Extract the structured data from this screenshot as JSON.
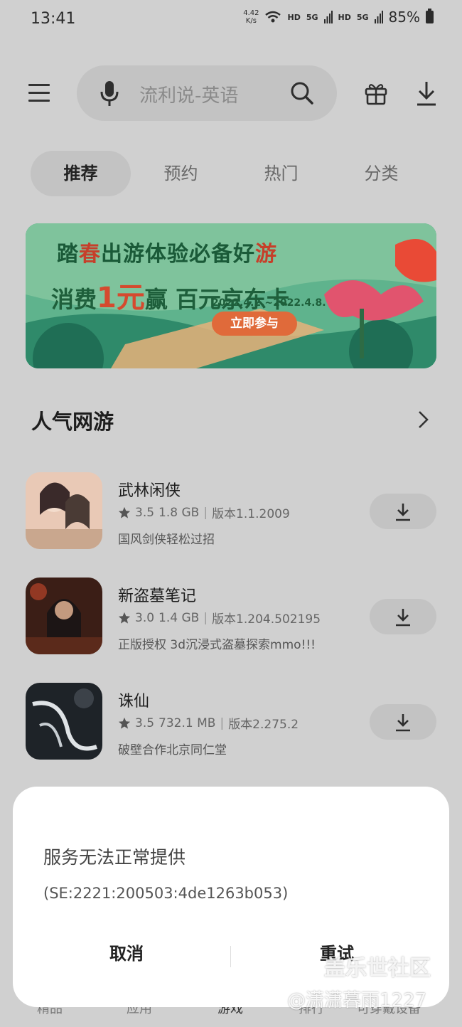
{
  "status_bar": {
    "time": "13:41",
    "net_speed_value": "4.42",
    "net_speed_unit": "K/s",
    "hd1": "HD",
    "sig1": "5G",
    "hd2": "HD",
    "sig2": "5G",
    "battery": "85%"
  },
  "header": {
    "search_placeholder": "流利说-英语",
    "icons": [
      "menu-icon",
      "mic-icon",
      "search-icon",
      "gift-icon",
      "download-icon"
    ]
  },
  "tabs": [
    {
      "label": "推荐",
      "active": true
    },
    {
      "label": "预约",
      "active": false
    },
    {
      "label": "热门",
      "active": false
    },
    {
      "label": "分类",
      "active": false
    }
  ],
  "banner": {
    "title_pre": "踏",
    "title_hl1": "春",
    "title_mid": "出游体验必备好",
    "title_hl2": "游",
    "main_pre": "消费",
    "main_amount": "1元",
    "main_win": "赢",
    "main_prize": "百元京东卡",
    "date": "2022.4.2.~2022.4.8.",
    "button": "立即参与"
  },
  "section": {
    "title": "人气网游"
  },
  "apps": [
    {
      "name": "武林闲侠",
      "rating": "3.5",
      "size": "1.8 GB",
      "version": "版本1.1.2009",
      "desc": "国风剑侠轻松过招"
    },
    {
      "name": "新盗墓笔记",
      "rating": "3.0",
      "size": "1.4 GB",
      "version": "版本1.204.502195",
      "desc": "正版授权 3d沉浸式盗墓探索mmo!!!"
    },
    {
      "name": "诛仙",
      "rating": "3.5",
      "size": "732.1 MB",
      "version": "版本2.275.2",
      "desc": "破壁合作北京同仁堂"
    }
  ],
  "bottom_nav": [
    "精品",
    "应用",
    "游戏",
    "排行",
    "可穿戴设备"
  ],
  "dialog": {
    "title": "服务无法正常提供",
    "code": "(SE:2221:200503:4de1263b053)",
    "cancel": "取消",
    "retry": "重试"
  },
  "watermark": {
    "line1": "盖乐世社区",
    "line2": "@潇潇暮雨1227"
  },
  "colors": {
    "background_dim": "#d0d0d0",
    "pill": "#c3c3c3",
    "dialog": "#ffffff",
    "banner_green": "#4aa07e",
    "banner_button": "#e06a3a"
  }
}
